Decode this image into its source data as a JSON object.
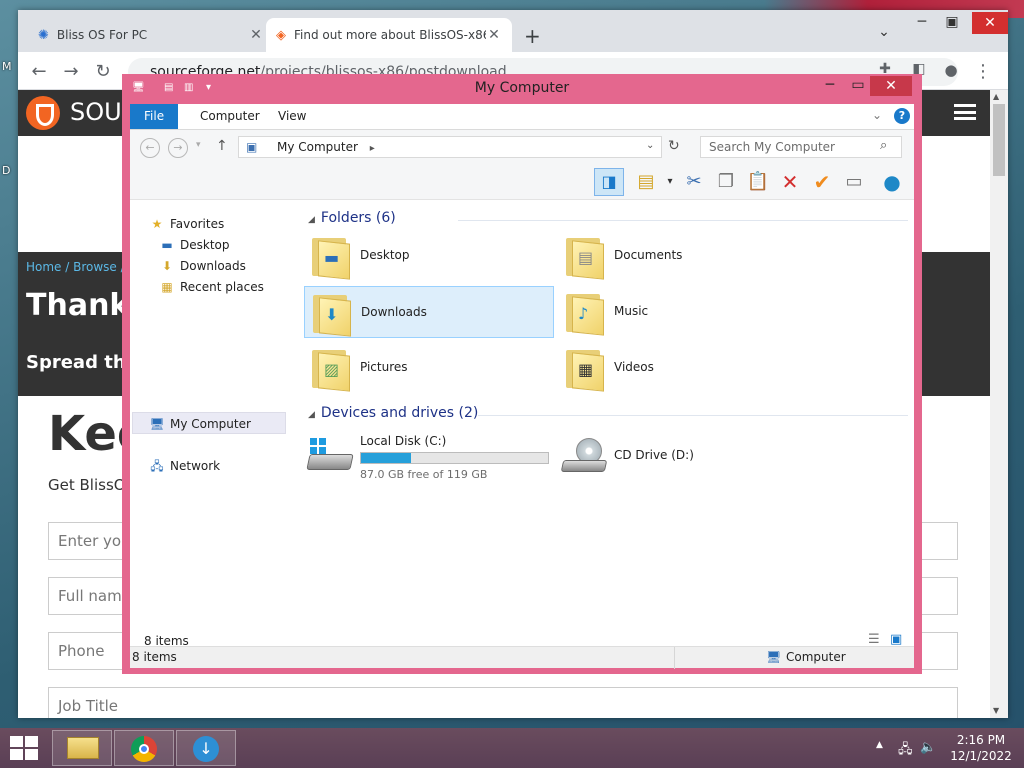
{
  "desktop": {
    "edge_letter_1": "M",
    "edge_letter_2": "D"
  },
  "browser": {
    "tabs": [
      {
        "title": "Bliss OS For PC",
        "active": false
      },
      {
        "title": "Find out more about BlissOS-x86",
        "active": true
      }
    ],
    "new_tab": "+",
    "url_host": "sourceforge.net",
    "url_path": "/projects/blissos-x86/postdownload"
  },
  "page": {
    "logo_text": "SOU",
    "breadcrumbs": "Home / Browse / S",
    "headline": "Thank y",
    "subhead": "Spread the W",
    "keep": "Kee",
    "get": "Get BlissO",
    "fields": [
      "Enter you",
      "Full name",
      "Phone",
      "Job Title"
    ]
  },
  "explorer": {
    "title": "My Computer",
    "ribbon_tabs": [
      "File",
      "Computer",
      "View"
    ],
    "address": "My Computer",
    "search_placeholder": "Search My Computer",
    "nav": {
      "favorites": "Favorites",
      "desktop": "Desktop",
      "downloads": "Downloads",
      "recent": "Recent places",
      "my_computer": "My Computer",
      "network": "Network"
    },
    "folders_header": "Folders (6)",
    "folders": [
      {
        "name": "Desktop",
        "icon": "desktop-folder-icon"
      },
      {
        "name": "Documents",
        "icon": "documents-folder-icon"
      },
      {
        "name": "Downloads",
        "icon": "downloads-folder-icon",
        "selected": true
      },
      {
        "name": "Music",
        "icon": "music-folder-icon"
      },
      {
        "name": "Pictures",
        "icon": "pictures-folder-icon"
      },
      {
        "name": "Videos",
        "icon": "videos-folder-icon"
      }
    ],
    "drives_header": "Devices and drives (2)",
    "drives": [
      {
        "name": "Local Disk (C:)",
        "free": "87.0 GB free of 119 GB",
        "used_fraction": 0.27
      },
      {
        "name": "CD Drive (D:)"
      }
    ],
    "item_count": "8 items",
    "status_count": "8 items",
    "status_location": "Computer"
  },
  "taskbar": {
    "time": "2:16 PM",
    "date": "12/1/2022"
  }
}
